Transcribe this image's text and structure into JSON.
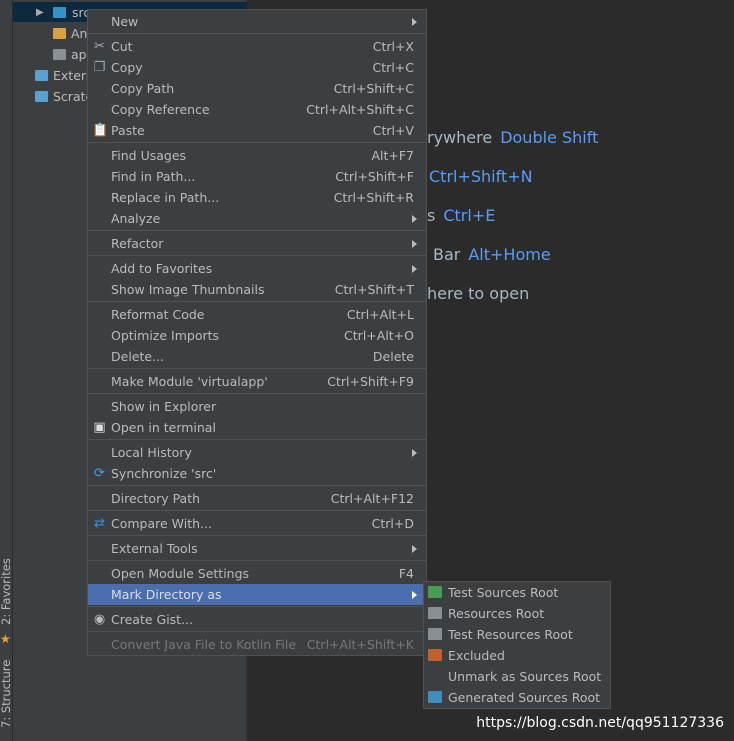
{
  "sidebar": {
    "tabs": [
      "2: Favorites",
      "7: Structure"
    ]
  },
  "project_tree": [
    {
      "label": "src",
      "icon": "folder-icon"
    },
    {
      "label": "An",
      "icon": "android-manifest-icon"
    },
    {
      "label": "ap",
      "icon": "table-file-icon"
    },
    {
      "label": "Extern",
      "icon": "libraries-icon"
    },
    {
      "label": "Scratc",
      "icon": "scratches-icon"
    }
  ],
  "editor_hints": [
    {
      "text": "rywhere",
      "key": "Double Shift"
    },
    {
      "text": "",
      "key": "Ctrl+Shift+N"
    },
    {
      "text": "s",
      "key": "Ctrl+E"
    },
    {
      "text": "Bar",
      "key": "Alt+Home"
    },
    {
      "text": "here to open",
      "key": ""
    }
  ],
  "context_menu": {
    "groups": [
      [
        {
          "label": "New",
          "submenu": true
        }
      ],
      [
        {
          "label": "Cut",
          "shortcut": "Ctrl+X",
          "icon": "scissors-icon"
        },
        {
          "label": "Copy",
          "shortcut": "Ctrl+C",
          "icon": "copy-icon"
        },
        {
          "label": "Copy Path",
          "shortcut": "Ctrl+Shift+C"
        },
        {
          "label": "Copy Reference",
          "shortcut": "Ctrl+Alt+Shift+C"
        },
        {
          "label": "Paste",
          "shortcut": "Ctrl+V",
          "icon": "paste-icon"
        }
      ],
      [
        {
          "label": "Find Usages",
          "shortcut": "Alt+F7"
        },
        {
          "label": "Find in Path...",
          "shortcut": "Ctrl+Shift+F"
        },
        {
          "label": "Replace in Path...",
          "shortcut": "Ctrl+Shift+R"
        },
        {
          "label": "Analyze",
          "submenu": true
        }
      ],
      [
        {
          "label": "Refactor",
          "submenu": true
        }
      ],
      [
        {
          "label": "Add to Favorites",
          "submenu": true
        },
        {
          "label": "Show Image Thumbnails",
          "shortcut": "Ctrl+Shift+T"
        }
      ],
      [
        {
          "label": "Reformat Code",
          "shortcut": "Ctrl+Alt+L"
        },
        {
          "label": "Optimize Imports",
          "shortcut": "Ctrl+Alt+O"
        },
        {
          "label": "Delete...",
          "shortcut": "Delete"
        }
      ],
      [
        {
          "label": "Make Module 'virtualapp'",
          "shortcut": "Ctrl+Shift+F9"
        }
      ],
      [
        {
          "label": "Show in Explorer"
        },
        {
          "label": "Open in terminal",
          "icon": "terminal-icon"
        }
      ],
      [
        {
          "label": "Local History",
          "submenu": true
        },
        {
          "label": "Synchronize 'src'",
          "icon": "sync-icon"
        }
      ],
      [
        {
          "label": "Directory Path",
          "shortcut": "Ctrl+Alt+F12"
        }
      ],
      [
        {
          "label": "Compare With...",
          "shortcut": "Ctrl+D",
          "icon": "compare-icon"
        }
      ],
      [
        {
          "label": "External Tools",
          "submenu": true
        }
      ],
      [
        {
          "label": "Open Module Settings",
          "shortcut": "F4"
        },
        {
          "label": "Mark Directory as",
          "submenu": true,
          "highlighted": true
        }
      ],
      [
        {
          "label": "Create Gist...",
          "icon": "github-icon"
        }
      ],
      [
        {
          "label": "Convert Java File to Kotlin File",
          "shortcut": "Ctrl+Alt+Shift+K",
          "disabled": true
        }
      ]
    ]
  },
  "submenu": [
    {
      "label": "Test Sources Root",
      "color": "#499c54"
    },
    {
      "label": "Resources Root",
      "color": "#8a8f94"
    },
    {
      "label": "Test Resources Root",
      "color": "#8a8f94"
    },
    {
      "label": "Excluded",
      "color": "#c1602b"
    },
    {
      "label": "Unmark as Sources Root",
      "color": ""
    },
    {
      "label": "Generated Sources Root",
      "color": "#3d8eb9"
    }
  ],
  "watermark": "https://blog.csdn.net/qq951127336"
}
